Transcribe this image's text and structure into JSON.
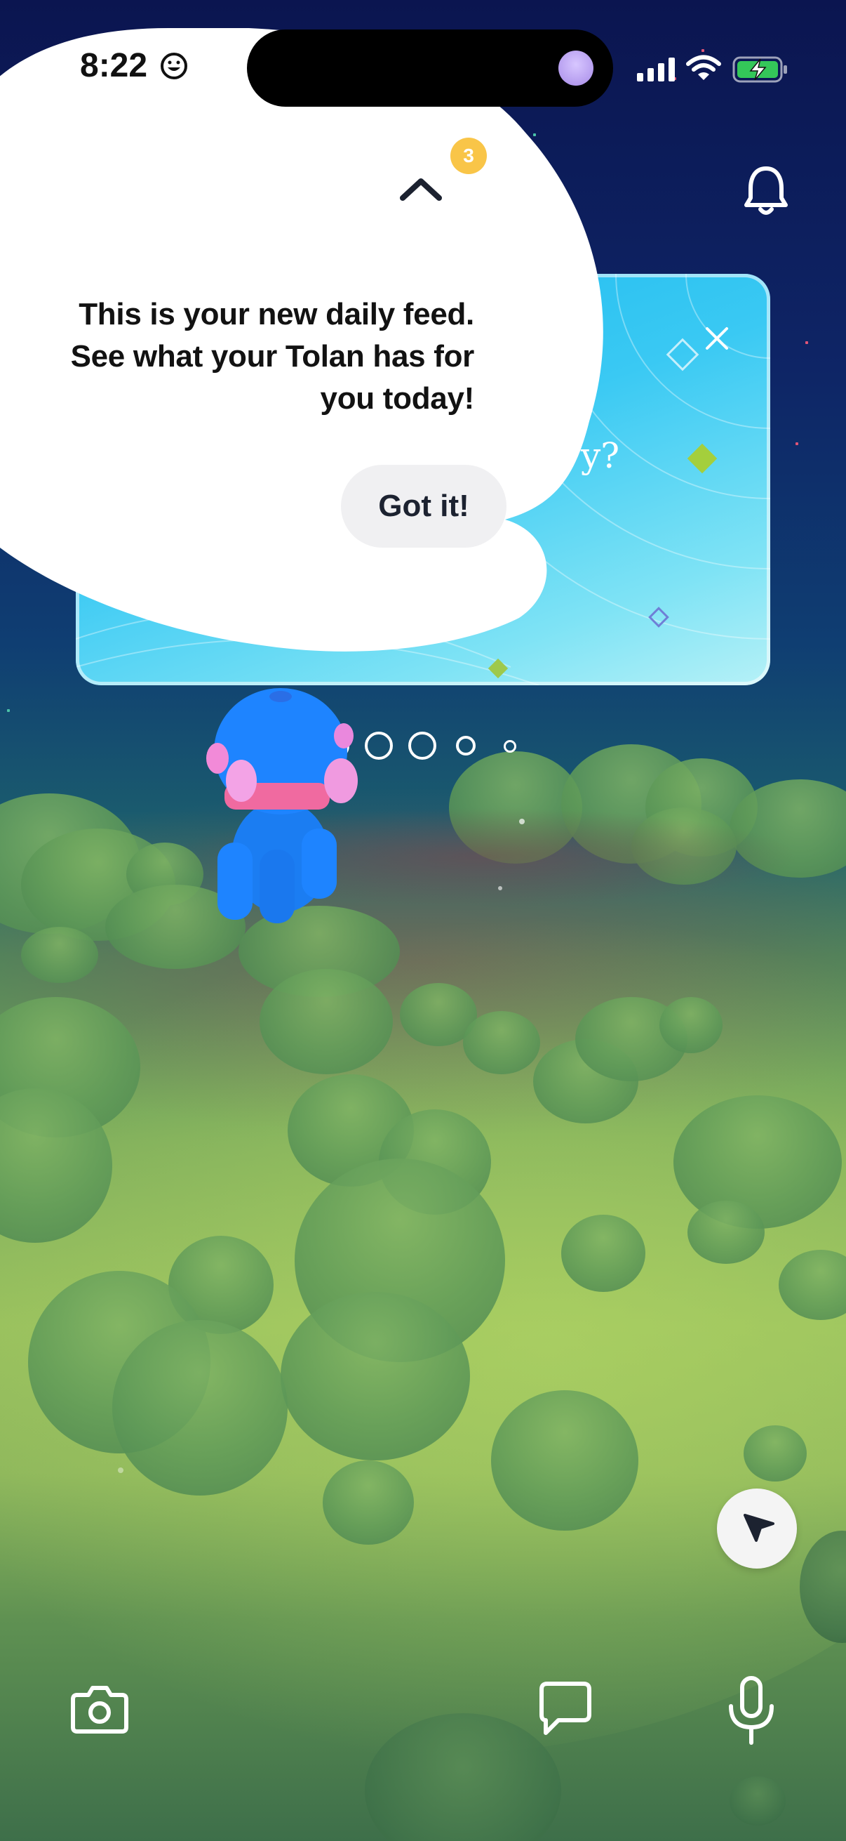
{
  "status_bar": {
    "time": "8:22",
    "emoji_icon": "smile-icon"
  },
  "onboarding": {
    "badge_count": "3",
    "message": "This is your new daily feed. See what your Tolan has for you today!",
    "button_label": "Got it!"
  },
  "feed_card": {
    "peek_text": "y?"
  },
  "pager": {
    "count": 5,
    "active_index": 0
  },
  "bottom_bar": {
    "camera_icon": "camera-icon",
    "chat_icon": "chat-icon",
    "mic_icon": "microphone-icon"
  },
  "colors": {
    "badge": "#f9c548",
    "card": "#3ac9f3",
    "character": "#1e84ff"
  }
}
